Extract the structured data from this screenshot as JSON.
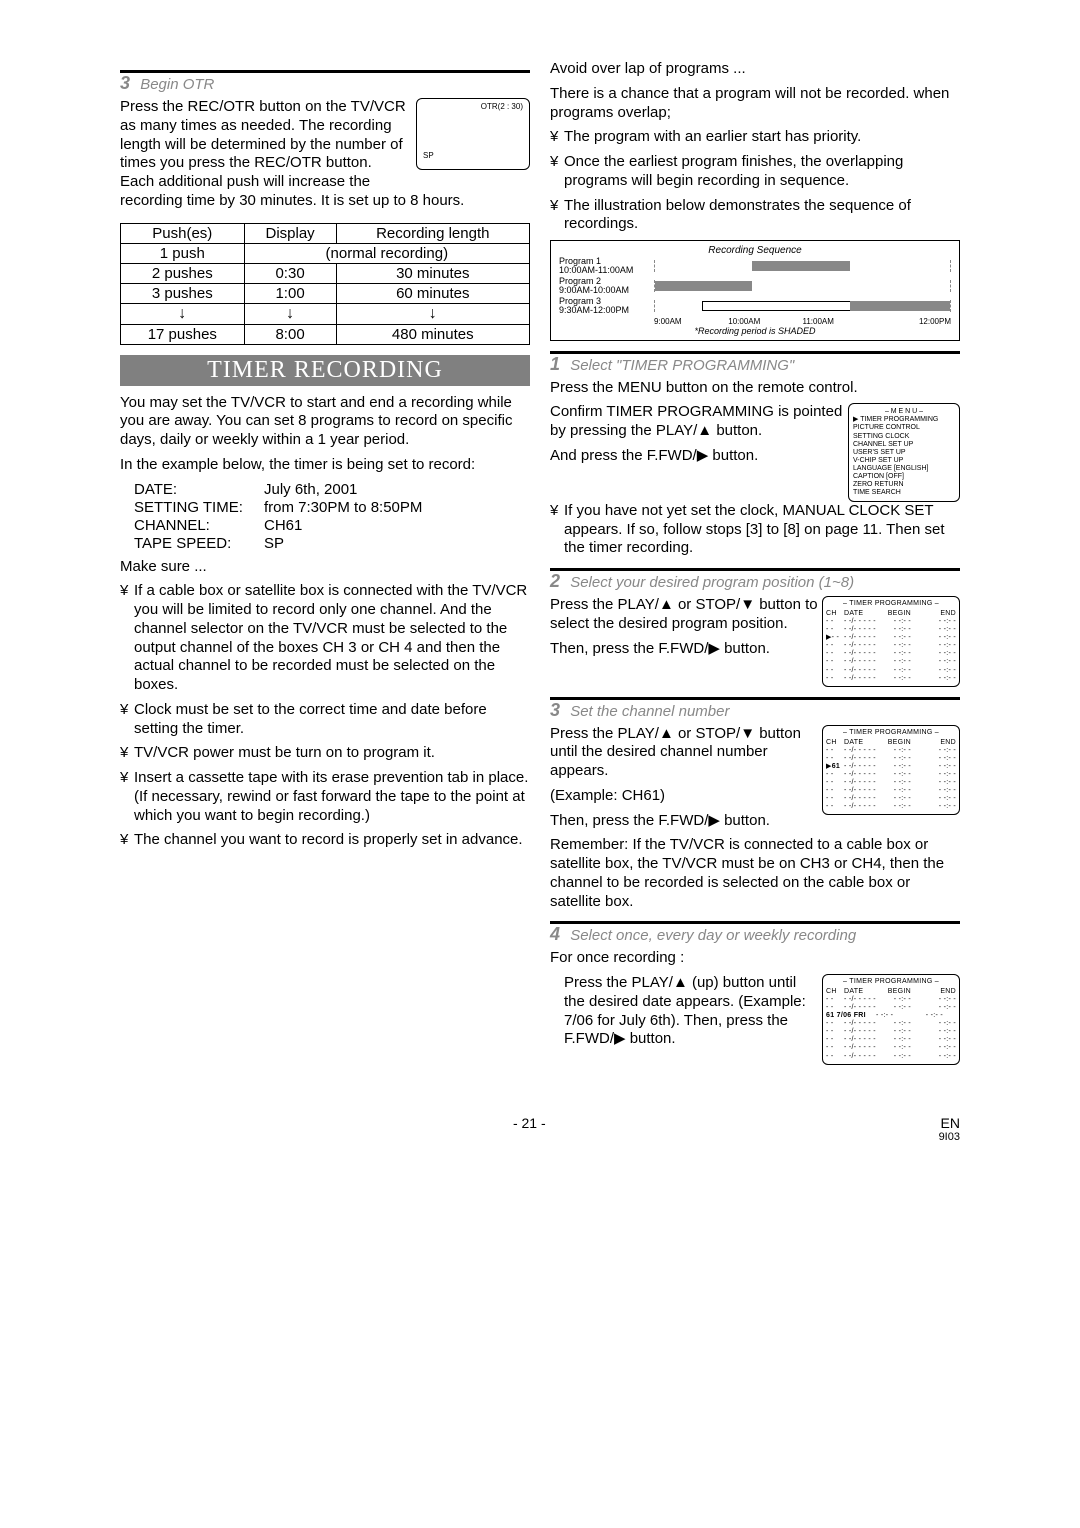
{
  "left": {
    "step3": {
      "num": "3",
      "title": "Begin OTR"
    },
    "begin_otr_para": "Press the REC/OTR button on the TV/VCR as many times as needed. The recording length will be determined by the number of times you press the REC/OTR button. Each additional push will increase the recording time by 30 minutes. It is set up to 8 hours.",
    "otr_small1": "OTR(2 : 30)",
    "otr_small2": "SP",
    "table": {
      "h1": "Push(es)",
      "h2": "Display",
      "h3": "Recording length",
      "r1c1": "1 push",
      "r1c23": "(normal recording)",
      "r2c1": "2 pushes",
      "r2c2": "0:30",
      "r2c3": "30 minutes",
      "r3c1": "3 pushes",
      "r3c2": "1:00",
      "r3c3": "60 minutes",
      "r5c1": "17 pushes",
      "r5c2": "8:00",
      "r5c3": "480 minutes"
    },
    "section_title": "TIMER RECORDING",
    "intro": "You may set the TV/VCR to start and end a recording while you are away. You can set 8 programs to record on specific days, daily or weekly within a 1 year period.",
    "example_lead": "In the example below, the timer is being set to record:",
    "ex_date_lbl": "DATE:",
    "ex_date_val": "July 6th, 2001",
    "ex_time_lbl": "SETTING TIME:",
    "ex_time_val": "from 7:30PM to 8:50PM",
    "ex_ch_lbl": "CHANNEL:",
    "ex_ch_val": "CH61",
    "ex_sp_lbl": "TAPE SPEED:",
    "ex_sp_val": "SP",
    "make_sure": "Make sure ...",
    "b1": "If a cable box or satellite box is connected with the TV/VCR you will be limited to record only one channel.  And the channel selector on the TV/VCR must be selected to the output channel of the boxes CH 3 or CH 4 and then the actual channel to be recorded must be selected on the boxes.",
    "b2": "Clock must be set to the correct time and date before setting the timer.",
    "b3": "TV/VCR power must be turn on to program it.",
    "b4": "Insert a cassette tape with its erase prevention tab in place. (If necessary, rewind or fast forward the tape to the point at which you want to begin recording.)",
    "b5": "The channel you want to record is properly set in advance."
  },
  "right": {
    "avoid_title": "Avoid over lap of programs ...",
    "avoid_p": "There is a chance that a program will not be recorded. when programs overlap;",
    "ab1": "The program with an earlier start has priority.",
    "ab2": "Once the earliest program finishes, the overlapping programs will begin recording in sequence.",
    "ab3": "The illustration below demonstrates the sequence of recordings.",
    "seq_title": "Recording Sequence",
    "p1lbl": "Program 1\n10:00AM-11:00AM",
    "p2lbl": "Program 2\n9:00AM-10:00AM",
    "p3lbl": "Program 3\n9:30AM-12:00PM",
    "axis1": "9:00AM",
    "axis2": "10:00AM",
    "axis3": "11:00AM",
    "axis4": "12:00PM",
    "seq_note": "*Recording period is SHADED",
    "step1": {
      "num": "1",
      "title": "Select \"TIMER PROGRAMMING\""
    },
    "step1_p1": "Press the MENU button on the remote control.",
    "step1_p2": "Confirm  TIMER PROGRAMMING  is pointed by pressing the PLAY/▲  button.",
    "step1_p3": "And press the F.FWD/▶ button.",
    "step1_b": "If you have not yet set the clock,  MANUAL CLOCK SET  appears. If so, follow stops [3] to [8] on page 11. Then set the timer recording.",
    "menu_head": "– M E N U –",
    "menu_items": [
      "TIMER PROGRAMMING",
      "PICTURE CONTROL",
      "SETTING CLOCK",
      "CHANNEL SET UP",
      "USER'S SET UP",
      "V-CHIP SET UP",
      "LANGUAGE   [ENGLISH]",
      "CAPTION   [OFF]",
      "ZERO RETURN",
      "TIME SEARCH"
    ],
    "step2": {
      "num": "2",
      "title": "Select your desired program position (1~8)"
    },
    "step2_p1": "Press the PLAY/▲ or STOP/▼  button to select the desired program position.",
    "step2_p2": "Then, press the F.FWD/▶ button.",
    "prog_head": "– TIMER PROGRAMMING –",
    "prog_cols": {
      "c1": "CH",
      "c2": "DATE",
      "c3": "BEGIN",
      "c4": "END"
    },
    "step3": {
      "num": "3",
      "title": "Set the channel number"
    },
    "step3_p1": "Press the PLAY/▲ or STOP/▼  button until the desired channel number appears.",
    "step3_p2": "(Example: CH61)",
    "step3_p3": "Then, press the F.FWD/▶ button.",
    "step3_p4": "Remember: If the TV/VCR is connected to a cable box or satellite box, the TV/VCR must be on CH3 or CH4, then the channel to be recorded is selected on the cable box or satellite box.",
    "prog3_highlight": "61",
    "step4": {
      "num": "4",
      "title": "Select once, every day or weekly recording"
    },
    "step4_once": "For once recording :",
    "step4_p": "Press the PLAY/▲ (up) button until the desired date appears. (Example:  7/06  for July 6th). Then, press the F.FWD/▶ button.",
    "prog4_highlight": "61   7/06  FRI"
  },
  "footer": {
    "page": "- 21 -",
    "en": "EN",
    "code": "9I03"
  }
}
